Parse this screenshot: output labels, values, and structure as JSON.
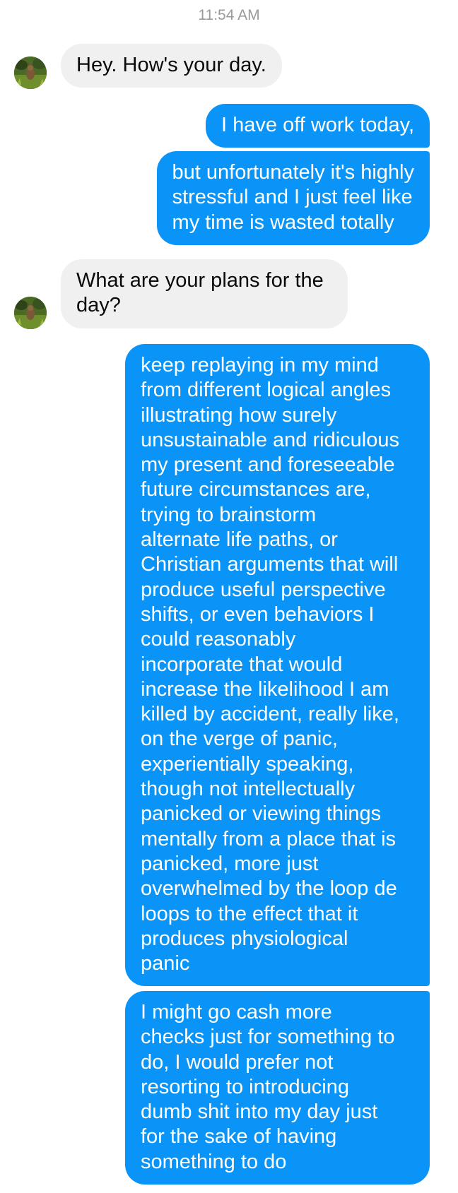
{
  "conversation": {
    "timestamp": "11:54 AM",
    "messages": [
      {
        "direction": "incoming",
        "lines": [
          "Hey. How's your day."
        ]
      },
      {
        "direction": "outgoing",
        "lines": [
          "I have off work today,"
        ]
      },
      {
        "direction": "outgoing",
        "lines": [
          "but unfortunately it's highly",
          "stressful and I just feel like",
          "my time is wasted totally"
        ]
      },
      {
        "direction": "incoming",
        "lines": [
          "What are your plans for the",
          "day?"
        ]
      },
      {
        "direction": "outgoing",
        "lines": [
          "keep replaying in my mind",
          "from different logical angles",
          "illustrating how surely",
          "unsustainable and ridiculous",
          "my present and foreseeable",
          "future circumstances are,",
          "trying to brainstorm",
          "alternate life paths, or",
          "Christian arguments that will",
          "produce useful perspective",
          "shifts, or even behaviors I",
          "could reasonably",
          "incorporate that would",
          "increase the likelihood I am",
          "killed by accident, really like,",
          "on the verge of panic,",
          "experientially speaking,",
          "though not intellectually",
          "panicked or viewing things",
          "mentally from a place that is",
          "panicked, more just",
          "overwhelmed by the loop de",
          "loops to the effect that it",
          "produces physiological",
          "panic"
        ]
      },
      {
        "direction": "outgoing",
        "lines": [
          "I might go cash more",
          "checks just for something to",
          "do, I would prefer not",
          "resorting to introducing",
          "dumb shit into my day just",
          "for the sake of having",
          "something to do"
        ]
      }
    ]
  },
  "colors": {
    "outgoing_bubble": "#0a94f7",
    "incoming_bubble": "#f0f0f0",
    "timestamp_text": "#9a9a9a"
  },
  "icons": {
    "contact_avatar": "contact-avatar-photo"
  }
}
